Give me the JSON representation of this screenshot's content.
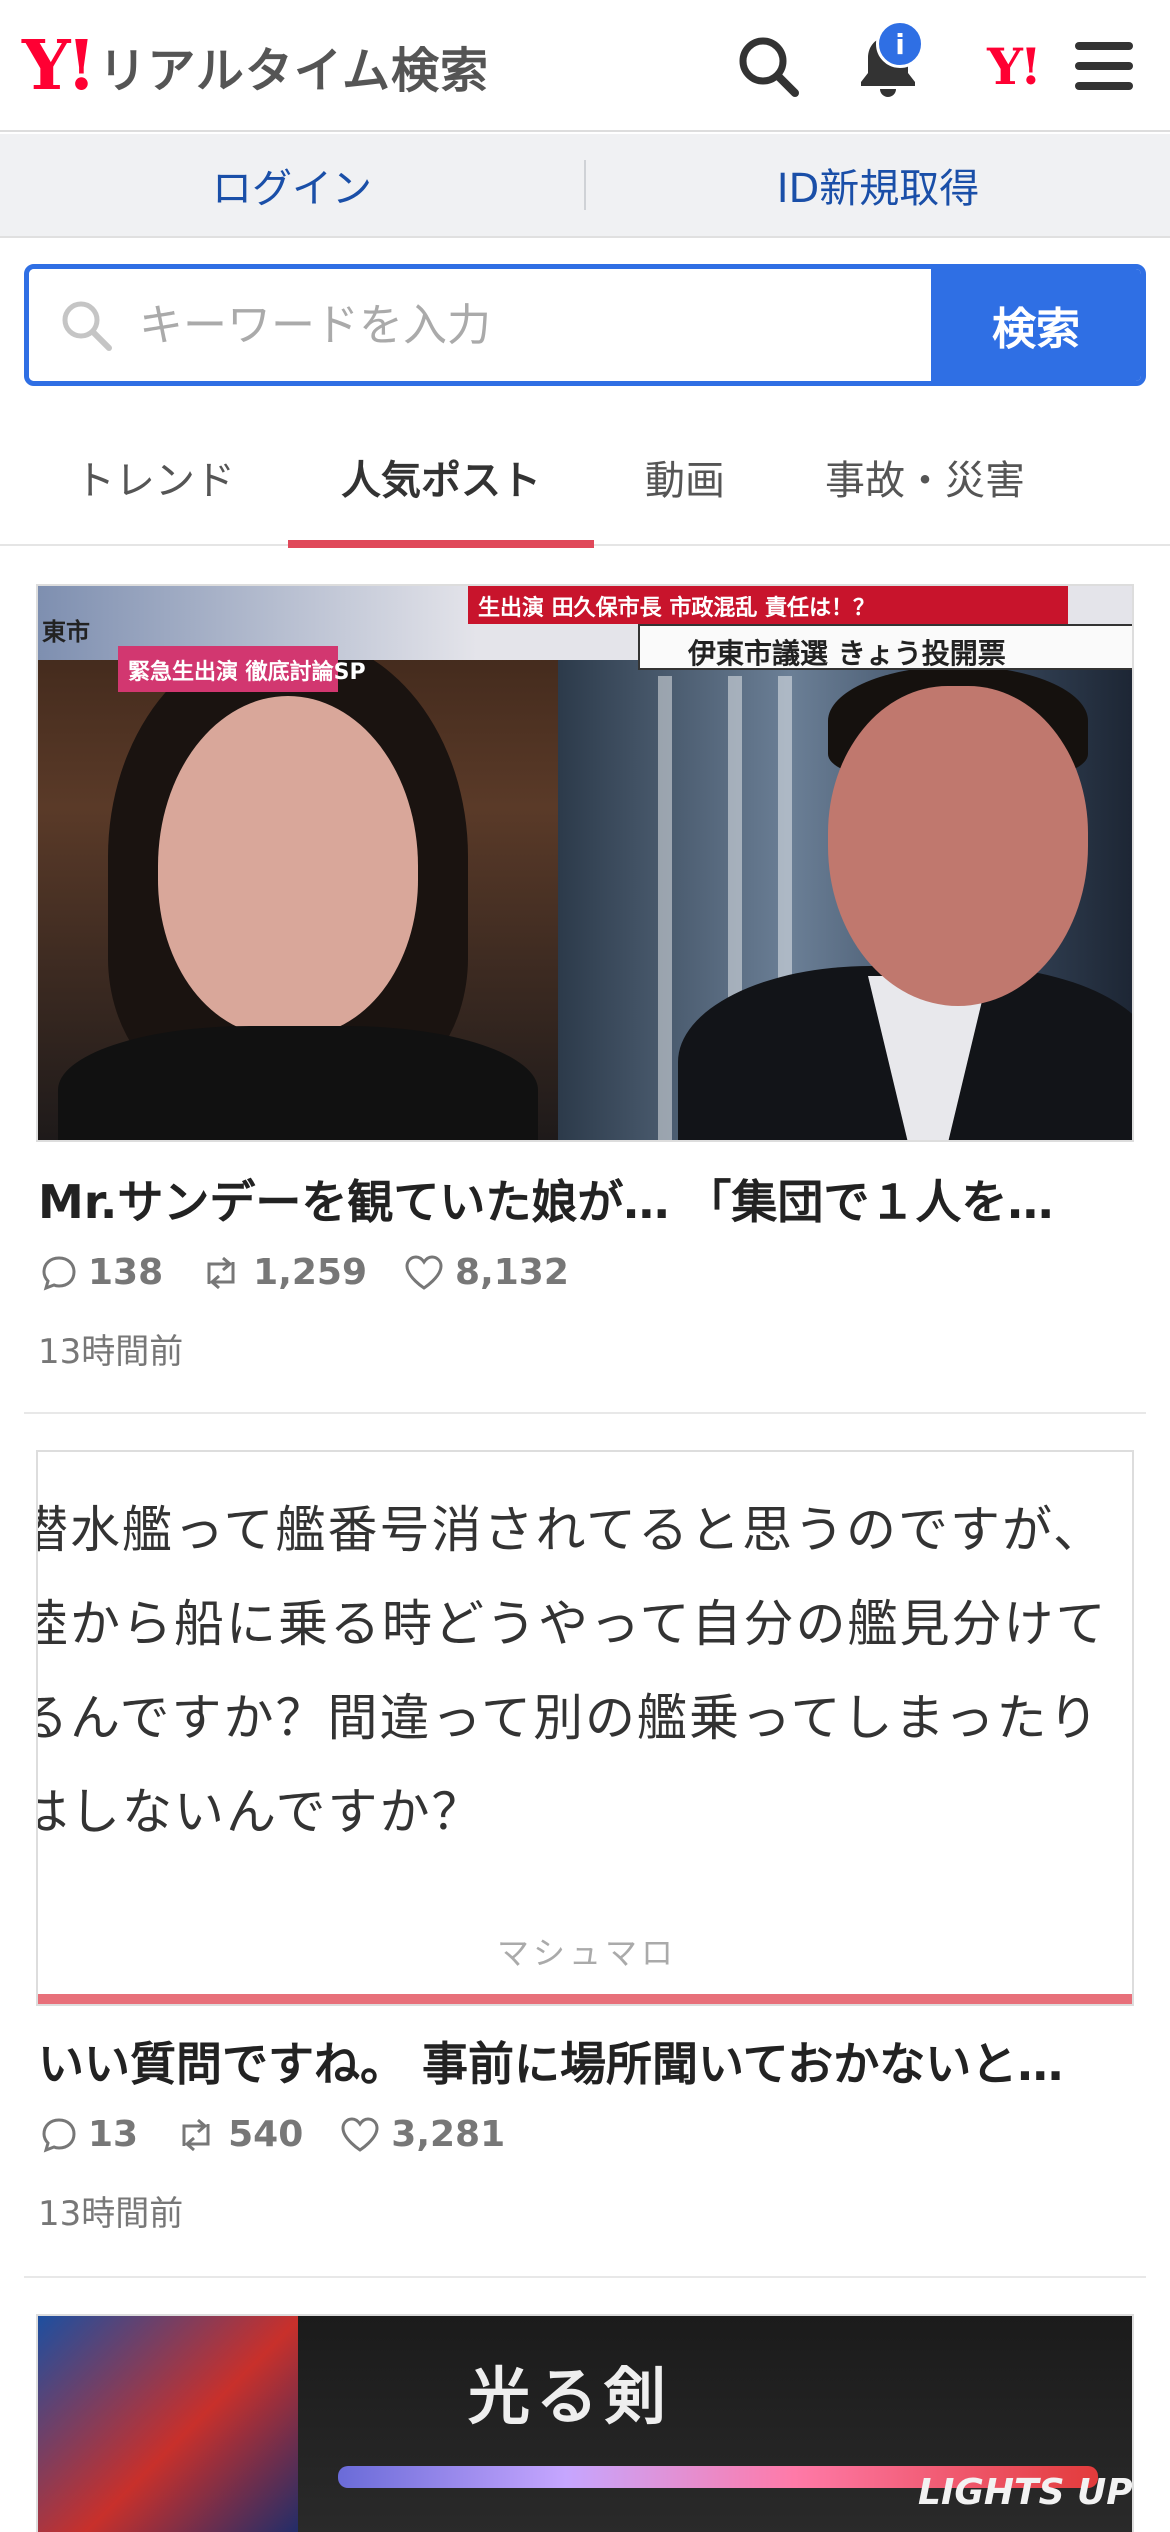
{
  "header": {
    "logo_mark": "Y!",
    "logo_text": "リアルタイム検索",
    "notification_badge": "i",
    "yahoo_mini": "Y!"
  },
  "login_bar": {
    "login": "ログイン",
    "register": "ID新規取得"
  },
  "search": {
    "placeholder": "キーワードを入力",
    "button": "検索"
  },
  "tabs": [
    {
      "label": "トレンド",
      "active": false
    },
    {
      "label": "人気ポスト",
      "active": true
    },
    {
      "label": "動画",
      "active": false
    },
    {
      "label": "事故・災害",
      "active": false
    }
  ],
  "posts": [
    {
      "title": "Mr.サンデーを観ていた娘が… 「集団で１人を…",
      "replies": "138",
      "reposts": "1,259",
      "likes": "8,132",
      "time": "13時間前",
      "image_texts": {
        "top_left": "東市",
        "pink_tag": "緊急生出演 徹底討論SP",
        "red_banner": "生出演 田久保市長 市政混乱 責任は！？",
        "white_banner": "伊東市議選 きょう投開票"
      }
    },
    {
      "title": "いい質問ですね。 事前に場所聞いておかないと…",
      "replies": "13",
      "reposts": "540",
      "likes": "3,281",
      "time": "13時間前",
      "image_lines": [
        "潜水艦って艦番号消されてると思うのですが、",
        "陸から船に乗る時どうやって自分の艦見分けて",
        "るんですか？間違って別の艦乗ってしまったり",
        "はしないんですか？"
      ],
      "image_brand": "マシュマロ"
    },
    {
      "image_texts": {
        "product_title": "光る剣",
        "product_subtitle": "LIGHTS UP SWO"
      }
    }
  ],
  "icons": {
    "search": "search-icon",
    "bell": "bell-icon",
    "menu": "hamburger-menu-icon",
    "reply": "reply-bubble-icon",
    "repost": "repost-icon",
    "like": "heart-icon"
  },
  "colors": {
    "brand_red": "#ff0033",
    "accent_blue": "#2f6fe4",
    "tab_underline": "#e0495a",
    "link_blue": "#1a4fa8"
  }
}
